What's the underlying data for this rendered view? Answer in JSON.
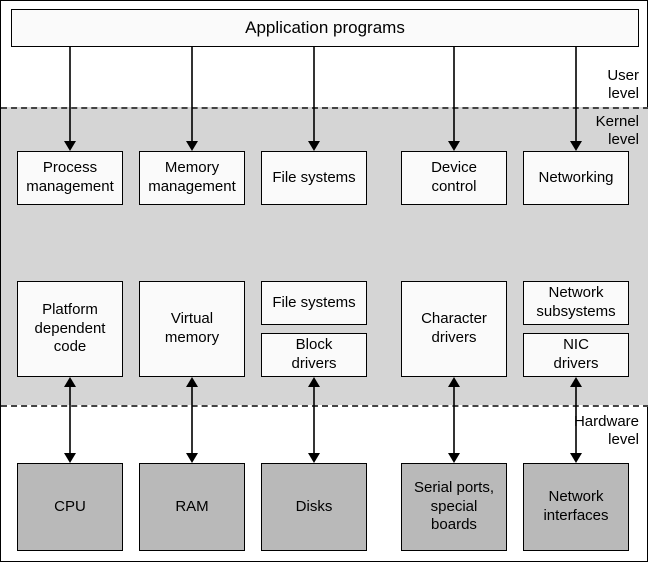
{
  "levels": {
    "user": "User\nlevel",
    "kernel": "Kernel\nlevel",
    "hardware": "Hardware\nlevel"
  },
  "top": {
    "app": "Application programs"
  },
  "kernel_upper": {
    "process": "Process\nmanagement",
    "memory": "Memory\nmanagement",
    "fs": "File systems",
    "device": "Device\ncontrol",
    "net": "Networking"
  },
  "kernel_lower": {
    "platform": "Platform\ndependent\ncode",
    "vmem": "Virtual\nmemory",
    "fs2": "File systems",
    "block": "Block\ndrivers",
    "chardrv": "Character\ndrivers",
    "netsub": "Network\nsubsystems",
    "nicdrv": "NIC\ndrivers"
  },
  "hardware": {
    "cpu": "CPU",
    "ram": "RAM",
    "disks": "Disks",
    "serial": "Serial ports,\nspecial\nboards",
    "netif": "Network\ninterfaces"
  }
}
